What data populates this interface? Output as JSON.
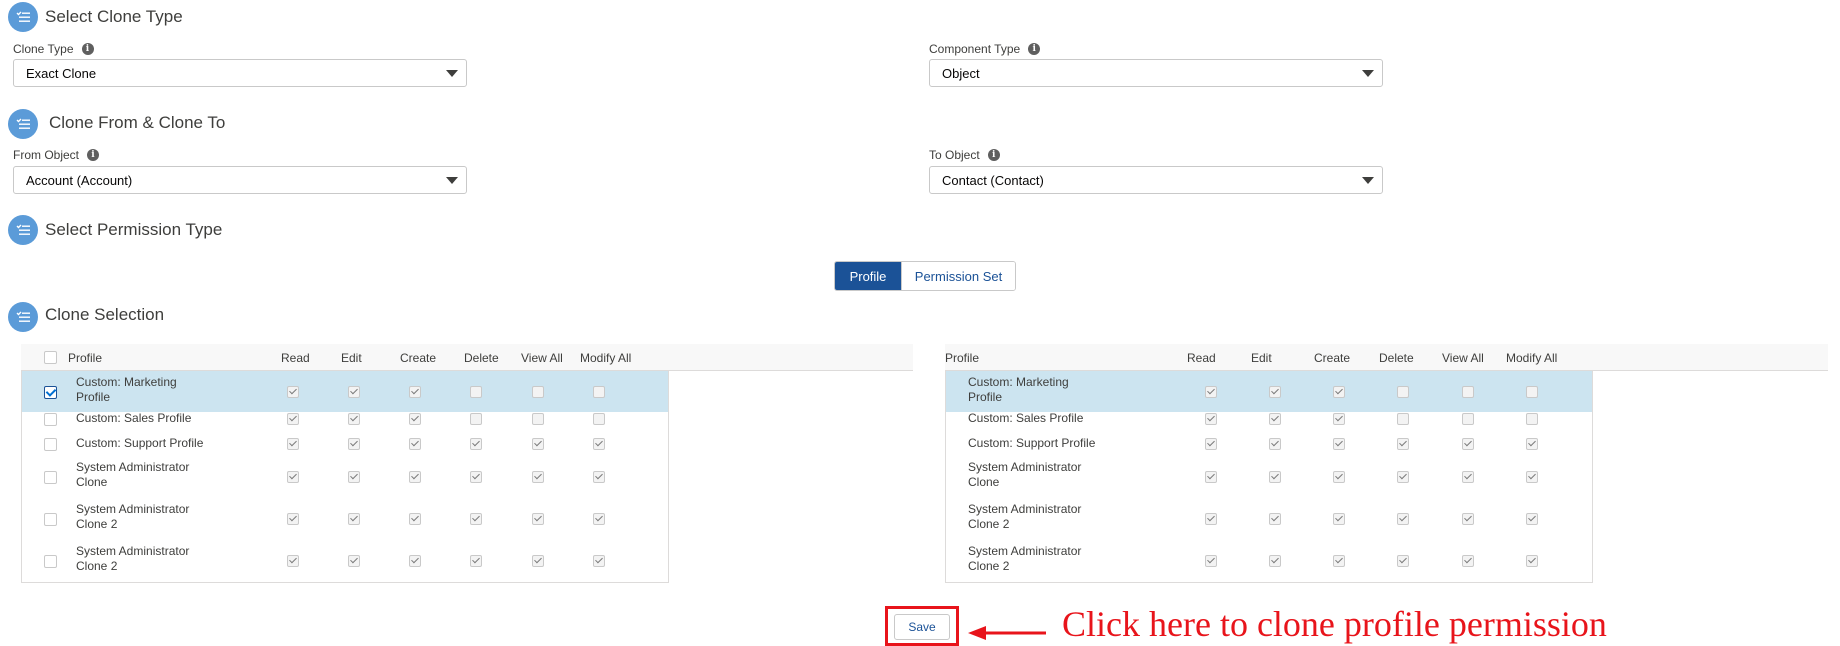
{
  "sections": {
    "clone_type": "Select Clone Type",
    "clone_from_to": "Clone From & Clone To",
    "permission_type": "Select Permission Type",
    "clone_selection": "Clone Selection"
  },
  "fields": {
    "clone_type": {
      "label": "Clone Type",
      "value": "Exact Clone"
    },
    "component_type": {
      "label": "Component Type",
      "value": "Object"
    },
    "from_object": {
      "label": "From Object",
      "value": "Account (Account)"
    },
    "to_object": {
      "label": "To Object",
      "value": "Contact (Contact)"
    }
  },
  "permission_toggle": {
    "profile": "Profile",
    "permission_set": "Permission Set",
    "selected": "Profile"
  },
  "table": {
    "columns": [
      "Profile",
      "Read",
      "Edit",
      "Create",
      "Delete",
      "View All",
      "Modify All"
    ],
    "rows": [
      {
        "line1": "Custom: Marketing",
        "line2": "Profile",
        "selected": true,
        "perms": [
          true,
          true,
          true,
          false,
          false,
          false
        ]
      },
      {
        "line1": "Custom: Sales Profile",
        "line2": "",
        "selected": false,
        "perms": [
          true,
          true,
          true,
          false,
          false,
          false
        ]
      },
      {
        "line1": "Custom: Support Profile",
        "line2": "",
        "selected": false,
        "perms": [
          true,
          true,
          true,
          true,
          true,
          true
        ]
      },
      {
        "line1": "System Administrator",
        "line2": "Clone",
        "selected": false,
        "perms": [
          true,
          true,
          true,
          true,
          true,
          true
        ]
      },
      {
        "line1": "System Administrator",
        "line2": "Clone 2",
        "selected": false,
        "perms": [
          true,
          true,
          true,
          true,
          true,
          true
        ]
      },
      {
        "line1": "System Administrator",
        "line2": "Clone 2",
        "selected": false,
        "perms": [
          true,
          true,
          true,
          true,
          true,
          true
        ]
      }
    ]
  },
  "save_button": "Save",
  "annotation": {
    "text": "Click here to clone profile permission",
    "color": "#e8141b"
  },
  "colors": {
    "brand": "#1b5297",
    "icon_bg": "#5b9bd8",
    "selected_row": "#cce4f0"
  }
}
